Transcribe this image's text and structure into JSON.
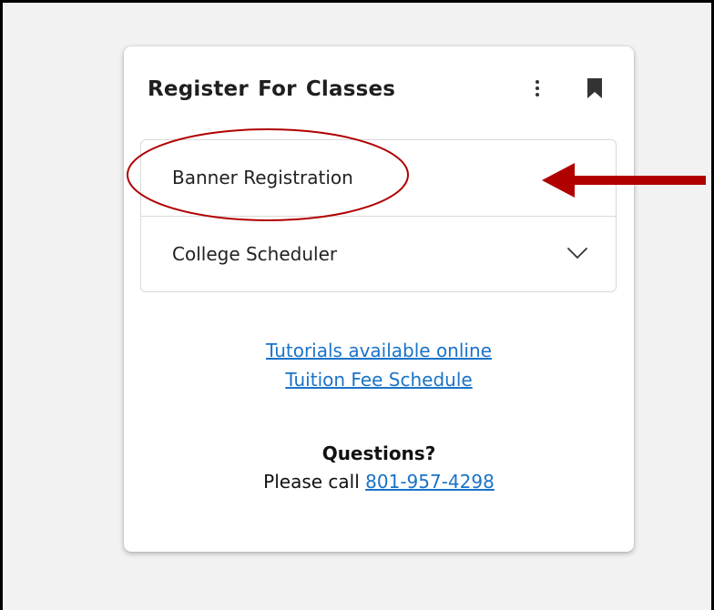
{
  "card": {
    "title": "Register For Classes",
    "menu_icon": "more-vertical-icon",
    "bookmark_icon": "bookmark-icon"
  },
  "list": {
    "items": [
      {
        "label": "Banner Registration",
        "expandable": false
      },
      {
        "label": "College Scheduler",
        "expandable": true,
        "icon": "chevron-down-icon"
      }
    ]
  },
  "links": {
    "tutorials": "Tutorials available online",
    "tuition": "Tuition Fee Schedule"
  },
  "contact": {
    "heading": "Questions?",
    "prefix": "Please call",
    "phone": "801-957-4298"
  },
  "annotation": {
    "color": "#b00000",
    "shapes": [
      "ellipse",
      "arrow"
    ]
  },
  "colors": {
    "link": "#1a73c8",
    "page_bg": "#f2f2f2",
    "card_bg": "#ffffff"
  }
}
